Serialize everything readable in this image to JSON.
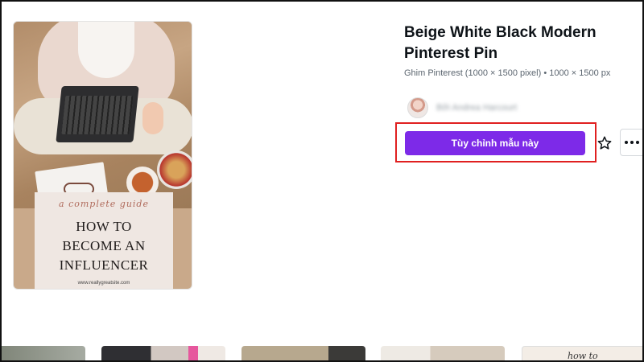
{
  "template": {
    "title": "Beige White Black Modern Pinterest Pin",
    "meta": "Ghim Pinterest (1000 × 1500 pixel) • 1000 × 1500 px",
    "author_name": "Bởi Andrea Harcourt",
    "cta_label": "Tùy chỉnh mẫu này",
    "accent_color": "#7d2ae8",
    "highlight_color": "#e02020"
  },
  "preview": {
    "subtitle": "a complete guide",
    "headline_lines": [
      "HOW TO",
      "BECOME AN",
      "INFLUENCER"
    ],
    "website": "www.reallygreatsite.com"
  },
  "icons": {
    "favorite": "star-icon",
    "more": "more-horizontal-icon"
  },
  "related": {
    "fifth_thumb_text": "how to"
  }
}
